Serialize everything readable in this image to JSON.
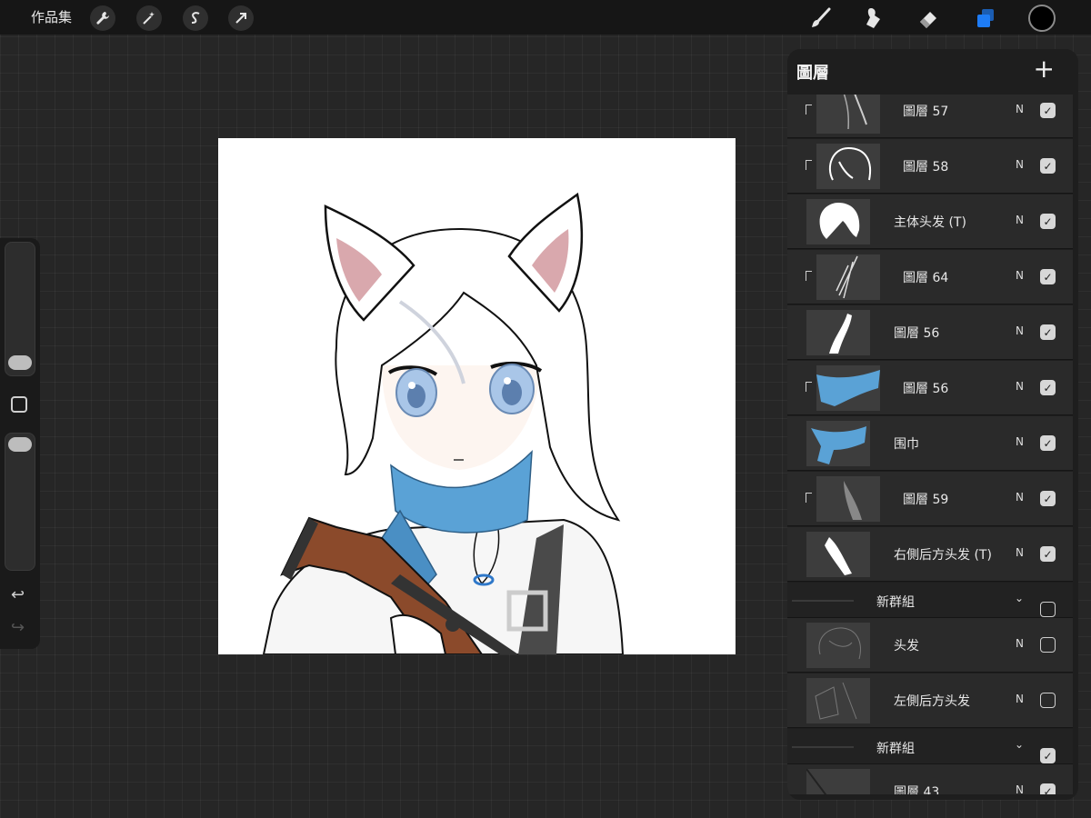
{
  "toolbar": {
    "gallery_label": "作品集",
    "left_tools": [
      {
        "name": "actions",
        "icon": "wrench-icon",
        "glyph": "🔧"
      },
      {
        "name": "adjustments",
        "icon": "magic-wand-icon",
        "glyph": "✦"
      },
      {
        "name": "selection",
        "icon": "selection-s-icon",
        "glyph": "S"
      },
      {
        "name": "transform",
        "icon": "arrow-cursor-icon",
        "glyph": "➚"
      }
    ],
    "right_tools": [
      {
        "name": "brush",
        "icon": "brush-icon"
      },
      {
        "name": "smudge",
        "icon": "smudge-icon"
      },
      {
        "name": "eraser",
        "icon": "eraser-icon"
      },
      {
        "name": "layers",
        "icon": "layers-icon",
        "active": true
      }
    ],
    "active_color": "#000000",
    "accent_color": "#1e7cf5"
  },
  "sidebar": {
    "brush_size_level": 0.12,
    "opacity_level": 0.96,
    "undo_icon": "undo-icon",
    "redo_icon": "redo-icon"
  },
  "layers_panel": {
    "title": "圖層",
    "add_icon": "plus-icon",
    "rows": [
      {
        "type": "layer",
        "name": "圖層 57",
        "blend": "N",
        "visible": true,
        "clipped": true,
        "thumb": "hair-strand"
      },
      {
        "type": "layer",
        "name": "圖層 58",
        "blend": "N",
        "visible": true,
        "clipped": true,
        "thumb": "hair-outline"
      },
      {
        "type": "layer",
        "name": "主体头发 (T)",
        "blend": "N",
        "visible": true,
        "clipped": false,
        "thumb": "hair-white"
      },
      {
        "type": "layer",
        "name": "圖層 64",
        "blend": "N",
        "visible": true,
        "clipped": true,
        "thumb": "strands"
      },
      {
        "type": "layer",
        "name": "圖層 56",
        "blend": "N",
        "visible": true,
        "clipped": false,
        "thumb": "lock-white"
      },
      {
        "type": "layer",
        "name": "圖層 56",
        "blend": "N",
        "visible": true,
        "clipped": true,
        "thumb": "scarf-shade"
      },
      {
        "type": "layer",
        "name": "围巾",
        "blend": "N",
        "visible": true,
        "clipped": false,
        "thumb": "scarf"
      },
      {
        "type": "layer",
        "name": "圖層 59",
        "blend": "N",
        "visible": true,
        "clipped": true,
        "thumb": "gray-stroke"
      },
      {
        "type": "layer",
        "name": "右側后方头发 (T)",
        "blend": "N",
        "visible": true,
        "clipped": false,
        "thumb": "hair-back"
      },
      {
        "type": "group",
        "name": "新群組",
        "visible": false
      },
      {
        "type": "layer",
        "name": "头发",
        "blend": "N",
        "visible": false,
        "clipped": false,
        "thumb": "sketch"
      },
      {
        "type": "layer",
        "name": "左側后方头发",
        "blend": "N",
        "visible": false,
        "clipped": false,
        "thumb": "sketch2"
      },
      {
        "type": "group",
        "name": "新群組",
        "visible": true
      },
      {
        "type": "layer",
        "name": "圖層 43",
        "blend": "N",
        "visible": true,
        "clipped": false,
        "thumb": "dark"
      }
    ]
  },
  "colors": {
    "scarf": "#5aa2d6",
    "scarf_shade": "#3c7fb3",
    "rifle_wood": "#8b4a2b",
    "rifle_metal": "#333333",
    "eye": "#a9c6e8"
  }
}
